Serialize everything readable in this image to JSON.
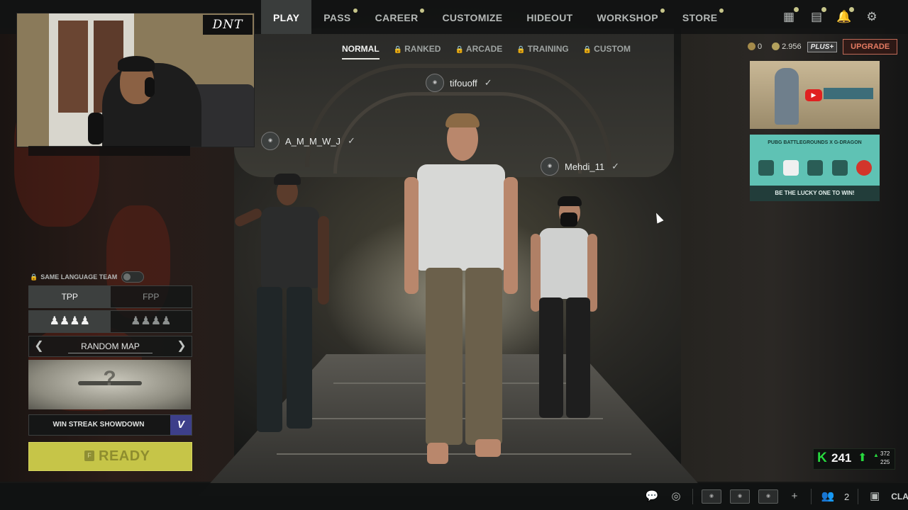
{
  "nav": {
    "items": [
      {
        "label": "PLAY",
        "active": true,
        "dot": false
      },
      {
        "label": "PASS",
        "active": false,
        "dot": true
      },
      {
        "label": "CAREER",
        "active": false,
        "dot": true
      },
      {
        "label": "CUSTOMIZE",
        "active": false,
        "dot": false
      },
      {
        "label": "HIDEOUT",
        "active": false,
        "dot": false
      },
      {
        "label": "WORKSHOP",
        "active": false,
        "dot": true
      },
      {
        "label": "STORE",
        "active": false,
        "dot": true
      }
    ],
    "icons": [
      "inventory-icon",
      "news-icon",
      "notifications-icon",
      "settings-icon"
    ]
  },
  "modes": [
    {
      "label": "NORMAL",
      "active": true,
      "locked": false
    },
    {
      "label": "RANKED",
      "active": false,
      "locked": true
    },
    {
      "label": "ARCADE",
      "active": false,
      "locked": true
    },
    {
      "label": "TRAINING",
      "active": false,
      "locked": true
    },
    {
      "label": "CUSTOM",
      "active": false,
      "locked": true
    }
  ],
  "currency": {
    "bp": "0",
    "gcoin": "2.956",
    "plus_label": "PLUS+",
    "upgrade_label": "UPGRADE"
  },
  "webcam": {
    "logo": "DNT"
  },
  "players": {
    "p1": "tifouoff",
    "p2": "A_M_M_W_J",
    "p3": "Mehdi_11"
  },
  "promo": {
    "header": "PUBG BATTLEGROUNDS X G-DRAGON",
    "footer": "BE THE LUCKY ONE TO WIN!"
  },
  "lobby": {
    "language_label": "SAME LANGUAGE TEAM",
    "perspective": [
      {
        "label": "TPP",
        "on": true
      },
      {
        "label": "FPP",
        "on": false
      }
    ],
    "squad": [
      {
        "label": "♟♟♟♟",
        "on": true
      },
      {
        "label": "♟♟♟♟",
        "on": false
      }
    ],
    "map_label": "RANDOM MAP",
    "map_glyph": "?",
    "event_label": "WIN STREAK SHOWDOWN",
    "event_badge": "V",
    "ready_key": "F",
    "ready_label": "READY"
  },
  "bottom": {
    "party_count": "2",
    "clan_label": "CLAN"
  },
  "stat": {
    "k": "K",
    "value": "241",
    "sub1": "372",
    "sub2": "225"
  }
}
